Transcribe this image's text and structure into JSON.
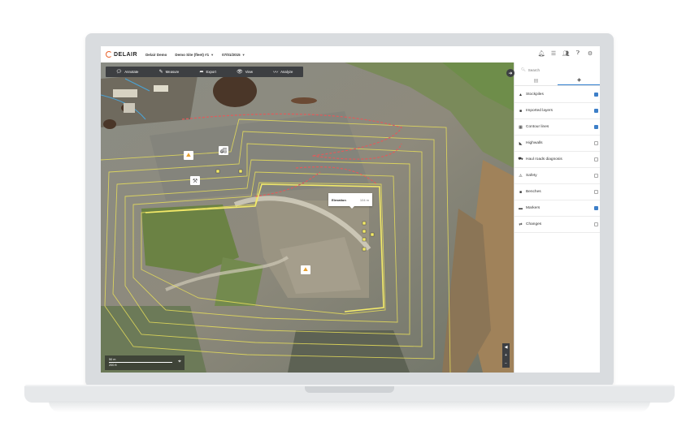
{
  "topbar": {
    "logo_text": "DELAIR",
    "org": "Delair Demo",
    "site": "Demo Site (fleet) #1",
    "date": "07/01/2015",
    "icons": [
      "bell-icon",
      "list-icon",
      "users-icon",
      "help-icon",
      "gear-icon"
    ]
  },
  "toolbar": {
    "annotate": "Annotate",
    "measure": "Measure",
    "export": "Export",
    "view": "View",
    "analyze": "Analyze"
  },
  "tooltip": {
    "label": "Elevation",
    "value": "104 m"
  },
  "scale": {
    "metric": "50 m",
    "imperial": "200 ft"
  },
  "panel": {
    "search_placeholder": "Search",
    "layers": [
      {
        "label": "Stockpiles",
        "icon": "stockpile-icon",
        "checked": true
      },
      {
        "label": "Imported layers",
        "icon": "folder-icon",
        "checked": true
      },
      {
        "label": "Contour lines",
        "icon": "contour-icon",
        "checked": true
      },
      {
        "label": "Highwalls",
        "icon": "highwall-icon",
        "checked": false
      },
      {
        "label": "Haul roads diagnosis",
        "icon": "truck-icon",
        "checked": false
      },
      {
        "label": "Safety",
        "icon": "safety-icon",
        "checked": false
      },
      {
        "label": "Benches",
        "icon": "folder-icon",
        "checked": false
      },
      {
        "label": "Markers",
        "icon": "marker-icon",
        "checked": true
      },
      {
        "label": "Changes",
        "icon": "changes-icon",
        "checked": false
      }
    ]
  },
  "colors": {
    "accent": "#3d7fc8",
    "toolbar": "#3d3f42",
    "logo": "#e8632b",
    "contour": "#e8df5a",
    "road": "#e05b5b"
  }
}
